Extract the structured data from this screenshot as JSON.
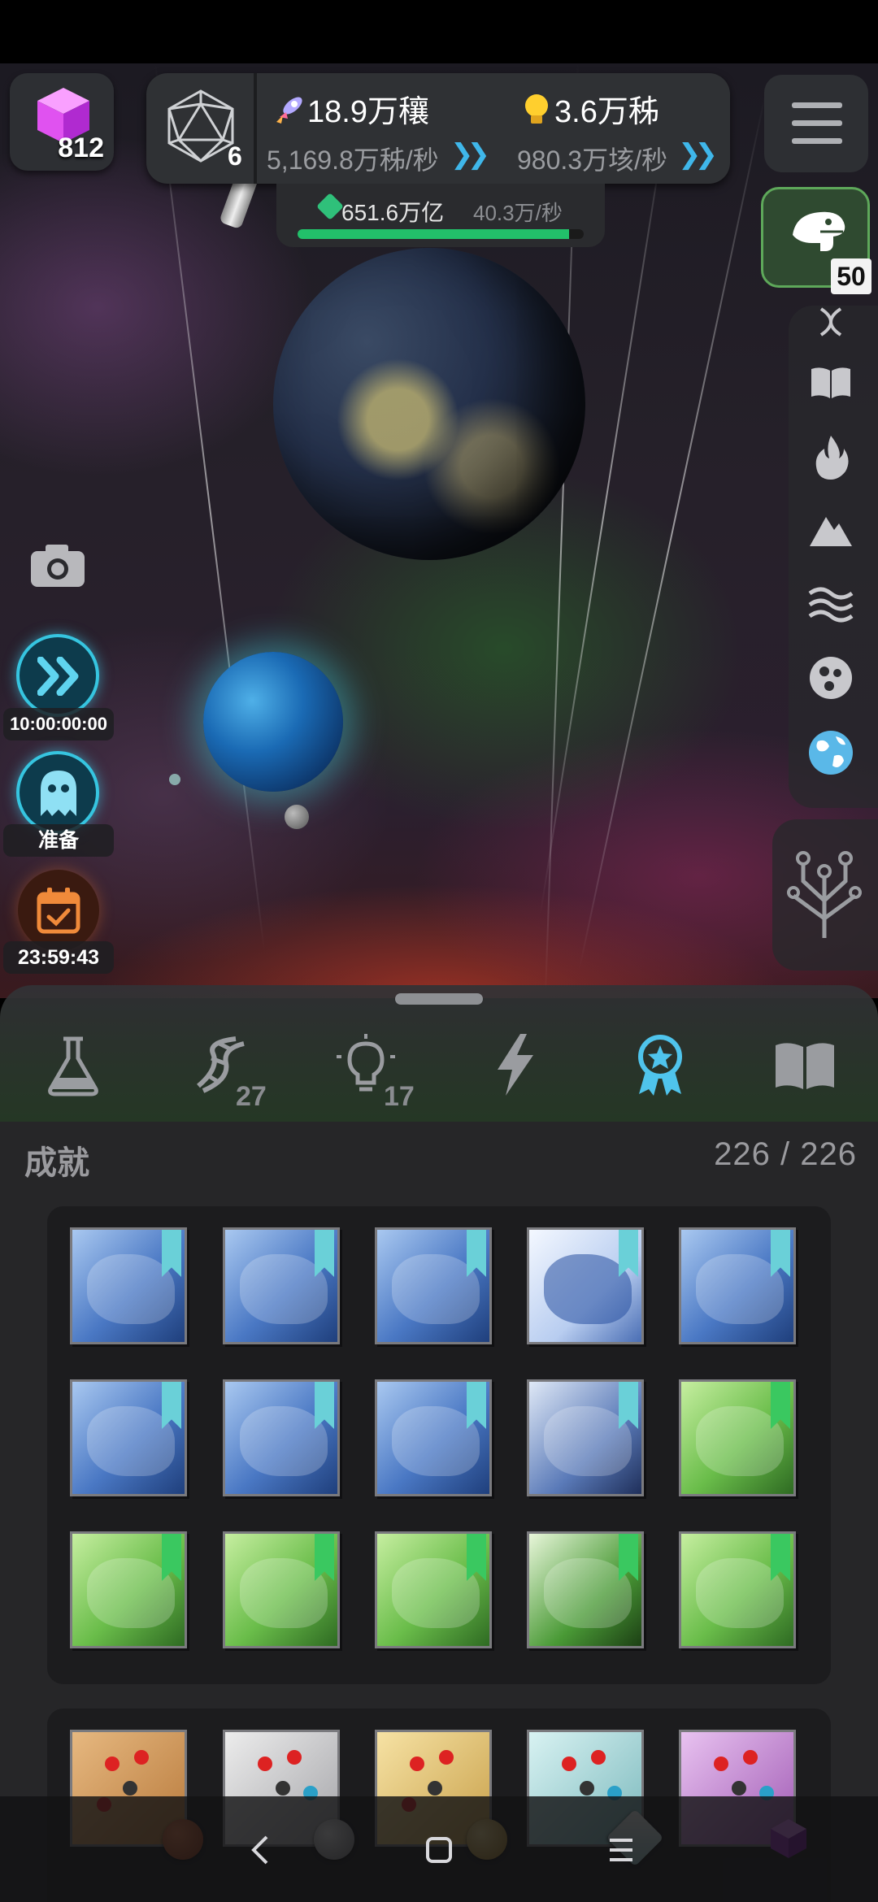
{
  "hud": {
    "gem_count": "812",
    "level_count": "6",
    "resource1_value": "18.9万穰",
    "resource1_rate": "5,169.8万秭/秒",
    "resource2_value": "3.6万秭",
    "resource2_rate": "980.3万垓/秒",
    "sub_value": "651.6万亿",
    "sub_rate": "40.3万/秒",
    "sub_progress": 0.95
  },
  "right_sidebar": {
    "dino_badge": "50",
    "icons": [
      "dna-icon",
      "book-icon",
      "fire-icon",
      "mountain-icon",
      "waves-icon",
      "cells-icon",
      "globe-icon"
    ]
  },
  "left_sidebar": {
    "speed_timer": "10:00:00:00",
    "ghost_label": "准备",
    "calendar_timer": "23:59:43"
  },
  "tabs": {
    "items": [
      "flask-icon",
      "dna-icon",
      "lightbulb-icon",
      "lightning-icon",
      "medal-icon",
      "book-icon"
    ],
    "dna_count": "27",
    "idea_count": "17",
    "active": "medal-icon"
  },
  "achievements": {
    "title": "成就",
    "count": "226 / 226"
  },
  "colors": {
    "accent": "#3fb7ea",
    "green": "#22c06a",
    "panel": "#262628"
  }
}
